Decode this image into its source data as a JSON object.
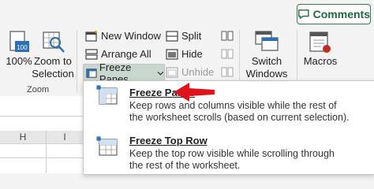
{
  "comments_button": {
    "label": "Comments",
    "icon": "comment-icon",
    "accent": "#1e6b42"
  },
  "zoom_group": {
    "zoom_100_label": "100%",
    "zoom_to_selection_label_line1": "Zoom to",
    "zoom_to_selection_label_line2": "Selection",
    "group_label": "Zoom"
  },
  "window_group": {
    "new_window": "New Window",
    "arrange_all": "Arrange All",
    "freeze_panes": "Freeze Panes",
    "split": "Split",
    "hide": "Hide",
    "unhide": "Unhide",
    "switch_windows_line1": "Switch",
    "switch_windows_line2": "Windows",
    "macros": "Macros"
  },
  "freeze_menu": {
    "items": [
      {
        "title": "Freeze Panes",
        "description_line1": "Keep rows and columns visible while the rest of",
        "description_line2": "the worksheet scrolls (based on current selection).",
        "icon": "freeze-panes-icon"
      },
      {
        "title": "Freeze Top Row",
        "description_line1": "Keep the top row visible while scrolling through",
        "description_line2": "the rest of the worksheet.",
        "icon": "freeze-top-row-icon"
      }
    ]
  },
  "sheet": {
    "column_headers": [
      "H",
      "I"
    ]
  },
  "colors": {
    "annotation_arrow": "#e0121b",
    "grid_green": "#1e6b42"
  }
}
